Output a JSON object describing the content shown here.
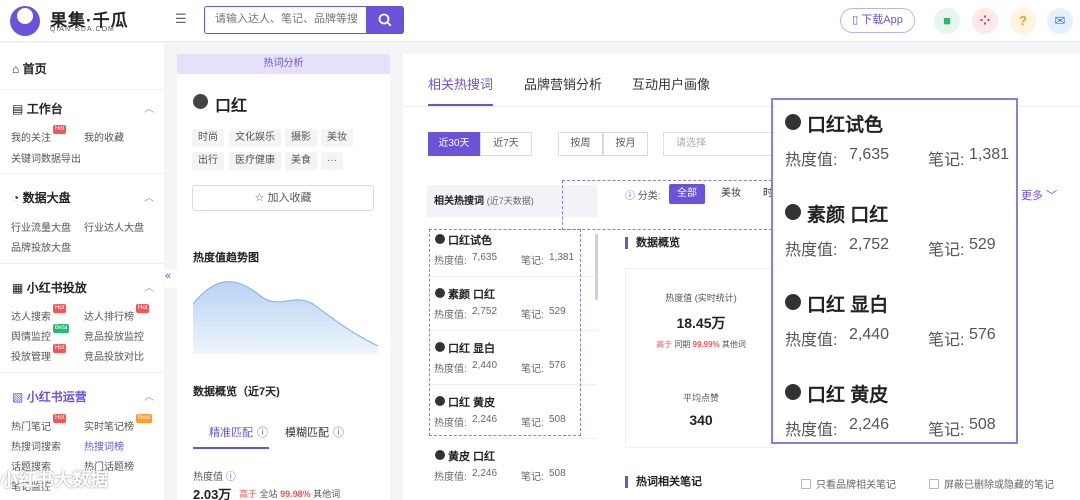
{
  "header": {
    "logo_cn": "果集·千瓜",
    "logo_en": "QIAN-GUA.COM",
    "search_placeholder": "请输入达人、笔记、品牌等搜",
    "download_label": "下载App"
  },
  "sidebar": {
    "home": "首页",
    "sections": [
      {
        "title": "工作台",
        "items": [
          "我的关注",
          "我的收藏",
          "关键词数据导出"
        ]
      },
      {
        "title": "数据大盘",
        "items": [
          "行业流量大盘",
          "行业达人大盘",
          "品牌投放大盘"
        ]
      },
      {
        "title": "小红书投放",
        "items": [
          "达人搜索",
          "达人排行榜",
          "舆情监控",
          "竞品投放监控",
          "投放管理",
          "竞品投放对比"
        ]
      },
      {
        "title": "小红书运营",
        "items": [
          "热门笔记",
          "实时笔记榜",
          "热搜词搜索",
          "热搜词榜",
          "话题搜索",
          "热门话题榜",
          "笔记监控"
        ]
      }
    ],
    "tags": {
      "hot": "Hot",
      "beta": "Beta",
      "new": "New"
    }
  },
  "keyword_panel": {
    "tab": "热词分析",
    "keyword": "口红",
    "tags": [
      "时尚",
      "文化娱乐",
      "摄影",
      "美妆",
      "出行",
      "医疗健康",
      "美食",
      "···"
    ],
    "favorite_label": "加入收藏",
    "trend_title": "热度值趋势图",
    "overview_title": "数据概览（近7天)",
    "match_tabs": [
      "精准匹配",
      "模糊匹配"
    ],
    "stat_label": "热度值",
    "stat_value": "2.03万",
    "stat_compare_prefix": "高于",
    "stat_compare_mid": "全站",
    "stat_compare_pct": "99.98%",
    "stat_compare_suffix": "其他词"
  },
  "main_panel": {
    "tabs": [
      "相关热搜词",
      "品牌营销分析",
      "互动用户画像"
    ],
    "range_pills": [
      "近30天",
      "近7天"
    ],
    "period_pills": [
      "按周",
      "按月"
    ],
    "select_placeholder": "请选择",
    "list_header": "相关热搜词",
    "list_header_note": "(近7天数据)",
    "heat_label": "热度值:",
    "notes_label": "笔记:",
    "list": [
      {
        "keyword": "口红试色",
        "heat": "7,635",
        "notes": "1,381"
      },
      {
        "keyword": "素颜 口红",
        "heat": "2,752",
        "notes": "529"
      },
      {
        "keyword": "口红 显白",
        "heat": "2,440",
        "notes": "576"
      },
      {
        "keyword": "口红 黄皮",
        "heat": "2,246",
        "notes": "508"
      },
      {
        "keyword": "黄皮 口红",
        "heat": "2,246",
        "notes": "508"
      }
    ],
    "category_label": "分类:",
    "categories": [
      "全部",
      "美妆",
      "时"
    ],
    "more_label": "更多",
    "overview_title": "数据概览",
    "card": {
      "heat_label": "热度值 (实时统计)",
      "heat_value": "18.45万",
      "compare_prefix": "高于",
      "compare_mid": "同期",
      "compare_pct": "99.99%",
      "compare_suffix": "其他词",
      "avg_label": "平均点赞",
      "avg_value": "340"
    },
    "notes_title": "热词相关笔记",
    "checkbox_brand": "只看品牌相关笔记",
    "checkbox_hidden": "屏蔽已删除或隐藏的笔记"
  },
  "zoom_popup": {
    "heat_label": "热度值:",
    "notes_label": "笔记:",
    "items": [
      {
        "keyword": "口红试色",
        "heat": "7,635",
        "notes": "1,381"
      },
      {
        "keyword": "素颜 口红",
        "heat": "2,752",
        "notes": "529"
      },
      {
        "keyword": "口红 显白",
        "heat": "2,440",
        "notes": "576"
      },
      {
        "keyword": "口红 黄皮",
        "heat": "2,246",
        "notes": "508"
      }
    ]
  },
  "watermark": "小红书大数据",
  "colors": {
    "accent": "#6c52d8",
    "hot": "#f25757",
    "beta": "#2bb673",
    "new": "#ff9c33",
    "compare_red": "#f25757"
  }
}
